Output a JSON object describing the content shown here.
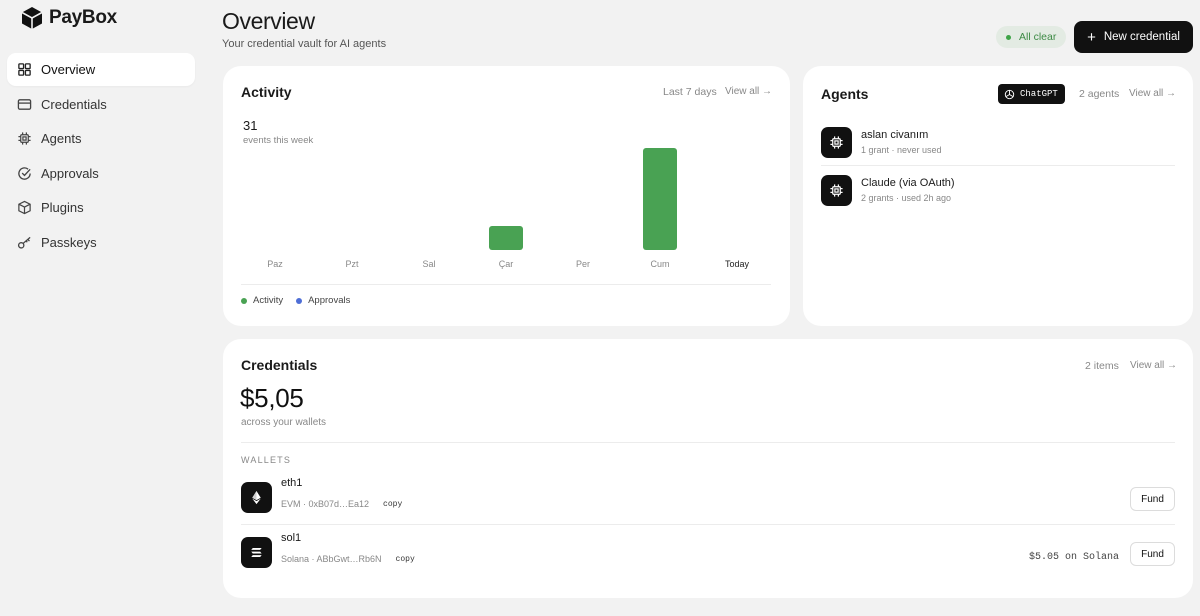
{
  "brand": {
    "name": "PayBox"
  },
  "sidebar": {
    "items": [
      {
        "label": "Overview",
        "icon": "grid-icon",
        "active": true
      },
      {
        "label": "Credentials",
        "icon": "card-icon"
      },
      {
        "label": "Agents",
        "icon": "chip-icon"
      },
      {
        "label": "Approvals",
        "icon": "check-circle-icon"
      },
      {
        "label": "Plugins",
        "icon": "box-icon"
      },
      {
        "label": "Passkeys",
        "icon": "key-icon"
      }
    ]
  },
  "header": {
    "title": "Overview",
    "subtitle": "Your credential vault for AI agents",
    "status": "All clear",
    "new_button": "New credential"
  },
  "activity": {
    "title": "Activity",
    "range": "Last 7 days",
    "view_all": "View all →",
    "count": "31",
    "count_label": "events this week",
    "legend": [
      "Activity",
      "Approvals"
    ]
  },
  "chart_data": {
    "type": "bar",
    "categories": [
      "Paz",
      "Pzt",
      "Sal",
      "Çar",
      "Per",
      "Cum",
      "Today"
    ],
    "series": [
      {
        "name": "Activity",
        "values": [
          0,
          0,
          0,
          6,
          0,
          25,
          0
        ],
        "color": "#49a253"
      },
      {
        "name": "Approvals",
        "values": [
          0,
          0,
          0,
          0,
          0,
          0,
          0
        ],
        "color": "#4e6ed6"
      }
    ],
    "ylim": [
      0,
      25
    ],
    "grid": false,
    "legend": "bottom-left"
  },
  "agents": {
    "title": "Agents",
    "chip": "ChatGPT",
    "count": "2 agents",
    "view_all": "View all →",
    "list": [
      {
        "name": "aslan civanım",
        "meta": "1 grant · never used"
      },
      {
        "name": "Claude (via OAuth)",
        "meta": "2 grants · used 2h ago"
      }
    ]
  },
  "credentials": {
    "title": "Credentials",
    "count": "2 items",
    "view_all": "View all →",
    "total": "$5,05",
    "total_label": "across your wallets",
    "section": "WALLETS",
    "wallets": [
      {
        "name": "eth1",
        "meta": "EVM · 0xB07d…Ea12",
        "copy": "copy",
        "balance": "",
        "fund": "Fund",
        "icon": "ethereum-icon"
      },
      {
        "name": "sol1",
        "meta": "Solana · ABbGwt…Rb6N",
        "copy": "copy",
        "balance": "$5.05 on Solana",
        "fund": "Fund",
        "icon": "solana-icon"
      }
    ]
  },
  "colors": {
    "accent": "#111111",
    "activity": "#49a253",
    "approvals": "#4e6ed6",
    "ok": "#3ea447"
  }
}
